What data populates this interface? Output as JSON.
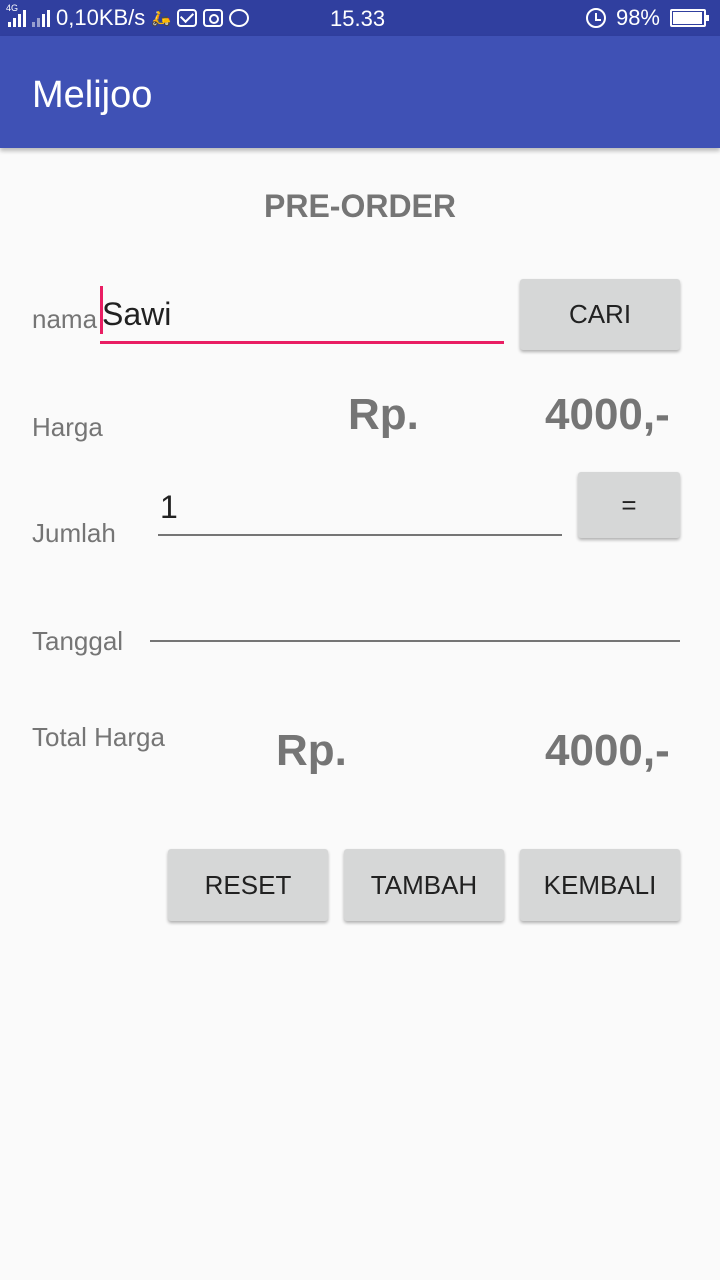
{
  "status_bar": {
    "network_tag_1": "4G",
    "speed": "0,10KB/s",
    "time": "15.33",
    "battery": "98%"
  },
  "app_bar": {
    "title": "Melijoo"
  },
  "form": {
    "heading": "PRE-ORDER",
    "nama_label": "nama",
    "nama_value": "Sawi",
    "cari_button": "CARI",
    "harga_label": "Harga",
    "harga_currency": "Rp.",
    "harga_value": "4000,-",
    "jumlah_label": "Jumlah",
    "jumlah_value": "1",
    "equals_button": "=",
    "tanggal_label": "Tanggal",
    "tanggal_value": "",
    "total_label": "Total Harga",
    "total_currency": "Rp.",
    "total_value": "4000,-"
  },
  "actions": {
    "reset": "RESET",
    "tambah": "TAMBAH",
    "kembali": "KEMBALI"
  },
  "colors": {
    "status_bar": "#303f9f",
    "app_bar": "#3f51b5",
    "accent": "#e91e63",
    "button": "#d6d7d7"
  }
}
